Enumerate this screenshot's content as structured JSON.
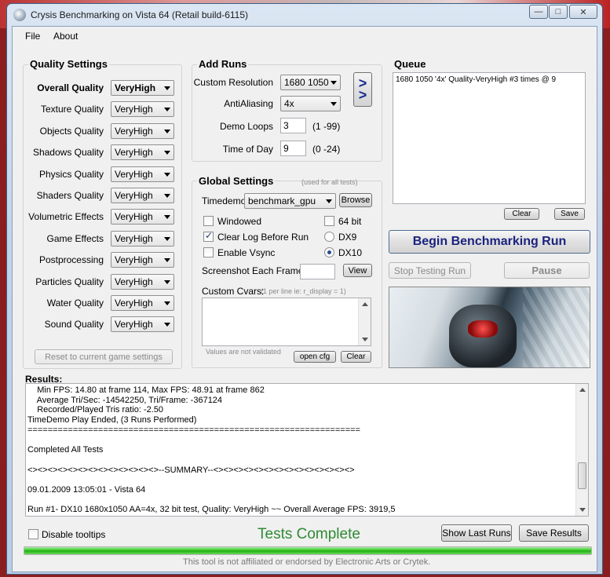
{
  "window": {
    "title": "Crysis Benchmarking on Vista 64 (Retail build-6115)",
    "controls": {
      "minimize": "—",
      "maximize": "□",
      "close": "✕"
    }
  },
  "menu": {
    "file": "File",
    "about": "About"
  },
  "quality": {
    "title": "Quality Settings",
    "rows": [
      {
        "label": "Overall Quality",
        "value": "VeryHigh"
      },
      {
        "label": "Texture Quality",
        "value": "VeryHigh"
      },
      {
        "label": "Objects Quality",
        "value": "VeryHigh"
      },
      {
        "label": "Shadows Quality",
        "value": "VeryHigh"
      },
      {
        "label": "Physics Quality",
        "value": "VeryHigh"
      },
      {
        "label": "Shaders Quality",
        "value": "VeryHigh"
      },
      {
        "label": "Volumetric Effects",
        "value": "VeryHigh"
      },
      {
        "label": "Game Effects",
        "value": "VeryHigh"
      },
      {
        "label": "Postprocessing",
        "value": "VeryHigh"
      },
      {
        "label": "Particles Quality",
        "value": "VeryHigh"
      },
      {
        "label": "Water Quality",
        "value": "VeryHigh"
      },
      {
        "label": "Sound Quality",
        "value": "VeryHigh"
      }
    ],
    "reset_button": "Reset to current game settings"
  },
  "add_runs": {
    "title": "Add Runs",
    "resolution_label": "Custom Resolution",
    "resolution_value": "1680 1050",
    "aa_label": "AntiAliasing",
    "aa_value": "4x",
    "loops_label": "Demo Loops",
    "loops_value": "3",
    "loops_range": "(1 -99)",
    "tod_label": "Time of Day",
    "tod_value": "9",
    "tod_range": "(0 -24)",
    "add_button": ">\n>"
  },
  "queue": {
    "title": "Queue",
    "items": [
      "1680 1050 '4x' Quality-VeryHigh #3 times @ 9"
    ],
    "clear_button": "Clear",
    "save_button": "Save"
  },
  "actions": {
    "begin": "Begin Benchmarking Run",
    "stop": "Stop Testing Run",
    "pause": "Pause"
  },
  "global": {
    "title": "Global Settings",
    "subtitle": "(used for all tests)",
    "timedemo_label": "Timedemo",
    "timedemo_value": "benchmark_gpu",
    "browse_button": "Browse",
    "windowed_label": "Windowed",
    "bit64_label": "64 bit",
    "clearlog_label": "Clear Log Before Run",
    "dx9_label": "DX9",
    "vsync_label": "Enable Vsync",
    "dx10_label": "DX10",
    "screenshot_label": "Screenshot Each Frame",
    "view_button": "View",
    "cvars_label": "Custom Cvars:",
    "cvars_hint": "(1 per line ie: r_display = 1)",
    "cvars_note": "Values are not validated",
    "opencfg_button": "open cfg",
    "clear_button": "Clear"
  },
  "results": {
    "label": "Results:",
    "lines": [
      "    Min FPS: 14.80 at frame 114, Max FPS: 48.91 at frame 862",
      "    Average Tri/Sec: -14542250, Tri/Frame: -367124",
      "    Recorded/Played Tris ratio: -2.50",
      "TimeDemo Play Ended, (3 Runs Performed)",
      "==================================================================",
      "",
      "Completed All Tests",
      "",
      "<><><><><><><><><><><><><>--SUMMARY--<><><><><><><><><><><><><><>",
      "",
      "09.01.2009 13:05:01 - Vista 64",
      "",
      "Run #1- DX10 1680x1050 AA=4x, 32 bit test, Quality: VeryHigh ~~ Overall Average FPS: 3919,5"
    ]
  },
  "footer": {
    "disable_tooltips": "Disable tooltips",
    "status": "Tests Complete",
    "show_last_runs": "Show Last Runs",
    "save_results": "Save Results",
    "progress": 1.0,
    "disclaimer": "This tool is not affiliated or endorsed by Electronic Arts or Crytek."
  }
}
